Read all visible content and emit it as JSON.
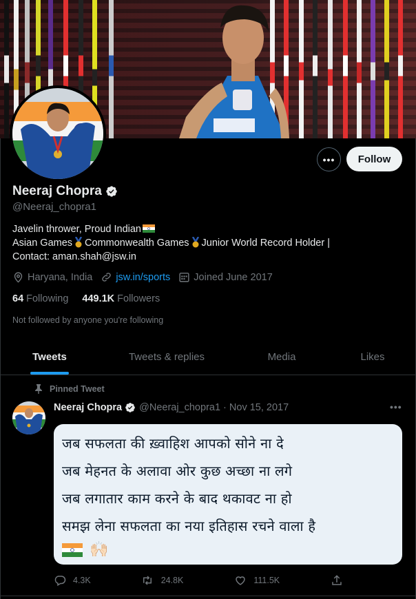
{
  "profile": {
    "name": "Neeraj Chopra",
    "handle": "@Neeraj_chopra1",
    "follow_label": "Follow",
    "more_label": "•••",
    "bio_line1": "Javelin thrower, Proud Indian",
    "bio_line2_a": "Asian Games",
    "bio_line2_b": "Commonwealth Games",
    "bio_line2_c": "Junior World Record Holder |",
    "bio_line3": "Contact: aman.shah@jsw.in",
    "location": "Haryana, India",
    "website": "jsw.in/sports",
    "joined": "Joined June 2017",
    "following_count": "64",
    "following_label": "Following",
    "followers_count": "449.1K",
    "followers_label": "Followers",
    "not_followed": "Not followed by anyone you're following"
  },
  "tabs": [
    {
      "label": "Tweets",
      "active": true
    },
    {
      "label": "Tweets & replies",
      "active": false
    },
    {
      "label": "Media",
      "active": false
    },
    {
      "label": "Likes",
      "active": false
    }
  ],
  "tweet": {
    "pinned_label": "Pinned Tweet",
    "author": "Neeraj Chopra",
    "handle_date": "@Neeraj_chopra1 · Nov 15, 2017",
    "more_label": "•••",
    "lines": [
      "जब सफलता की ख़्वाहिश आपको सोने ना दे",
      "जब मेहनत के अलावा ओर कुछ अच्छा ना लगे",
      "जब लगातार काम करने के बाद थकावट ना हो",
      "समझ लेना सफलता का नया इतिहास रचने वाला है"
    ],
    "emoji": "🙌🏻",
    "replies": "4.3K",
    "retweets": "24.8K",
    "likes": "111.5K"
  },
  "colors": {
    "accent": "#1d9bf0",
    "background": "#000000",
    "secondary_text": "#71767b"
  },
  "icons": [
    "verified-badge-icon",
    "location-icon",
    "link-icon",
    "calendar-icon",
    "pin-icon",
    "reply-icon",
    "retweet-icon",
    "like-icon",
    "share-icon",
    "more-icon",
    "india-flag-icon",
    "medal-icon"
  ]
}
